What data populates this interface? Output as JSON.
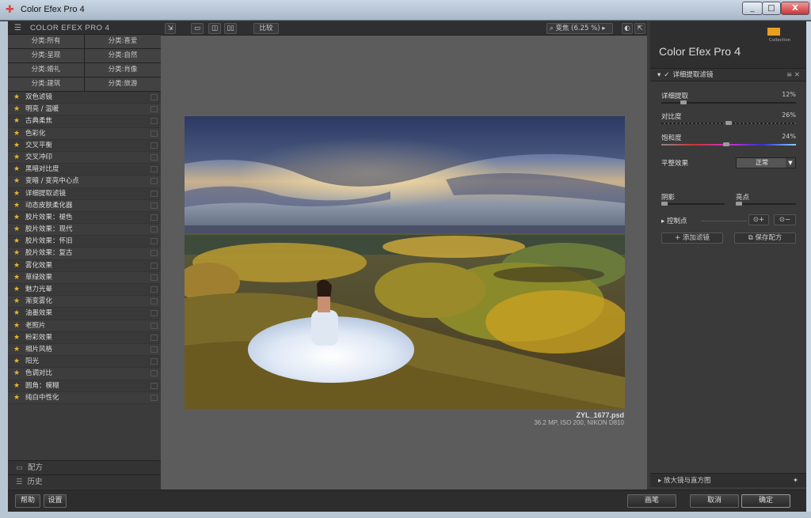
{
  "window": {
    "title": "Color Efex Pro 4",
    "min": "_",
    "max": "□",
    "close": "X"
  },
  "left": {
    "header": "COLOR EFEX PRO 4",
    "categories": [
      "分类:所有",
      "分类:喜爱",
      "分类:呈现",
      "分类:自然",
      "分类:婚礼",
      "分类:肖像",
      "分类:建筑",
      "分类:旅游"
    ],
    "filters": [
      "双色滤镜",
      "明亮 / 温暖",
      "古典柔焦",
      "色彩化",
      "交叉平衡",
      "交叉冲印",
      "黑暗对比度",
      "变暗 / 变亮中心点",
      "详细提取滤镜",
      "动态皮肤柔化器",
      "胶片效果：褪色",
      "胶片效果：现代",
      "胶片效果：怀旧",
      "胶片效果：复古",
      "雾化效果",
      "草绿效果",
      "魅力光晕",
      "渐变雾化",
      "油墨效果",
      "老照片",
      "粉彩效果",
      "相片风格",
      "阳光",
      "色调对比",
      "圆角：模糊",
      "纯白中性化"
    ],
    "recipes": "配方",
    "history": "历史"
  },
  "toolbar": {
    "compare": "比较",
    "zoom": "变焦 (6.25 %)"
  },
  "image": {
    "filename": "ZYL_1677.psd",
    "meta": "36.2 MP, ISO 200, NIKON D810"
  },
  "right": {
    "product": "Color Efex Pro",
    "version": "4",
    "logo_text": "Collection",
    "filter_name": "详细提取滤镜",
    "sliders": [
      {
        "label": "详细提取",
        "value": "12%",
        "pos": 0.15
      },
      {
        "label": "对比度",
        "value": "26%",
        "pos": 0.5
      },
      {
        "label": "饱和度",
        "value": "24%",
        "pos": 0.48
      }
    ],
    "grain_label": "平整效果",
    "grain_value": "正常",
    "shadow_label": "阴影",
    "highlight_label": "亮点",
    "control_points": "控制点",
    "add_filter": "添加滤镜",
    "save_recipe": "保存配方",
    "loupe": "放大镜与直方图"
  },
  "bottom": {
    "help": "帮助",
    "settings": "设置",
    "brush": "画笔",
    "cancel": "取消",
    "ok": "确定"
  }
}
